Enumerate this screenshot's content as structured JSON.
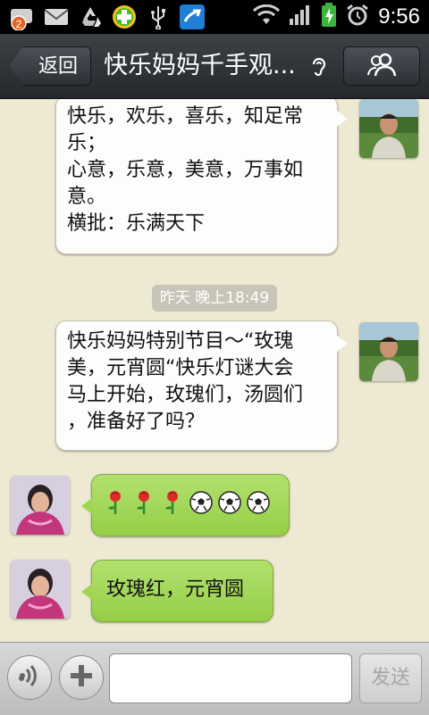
{
  "status_bar": {
    "notification_count": "2",
    "time": "9:56"
  },
  "header": {
    "back_label": "返回",
    "title": "快乐妈妈千手观..."
  },
  "messages": [
    {
      "side": "right",
      "lines": [
        "快乐，欢乐，喜乐，知足常",
        "乐；",
        "心意，乐意，美意，万事如",
        "意。",
        "横批：乐满天下"
      ]
    },
    {
      "timestamp": "昨天 晚上18:49"
    },
    {
      "side": "right",
      "lines": [
        "快乐妈妈特别节目～“玫瑰",
        "美，元宵圆“快乐灯谜大会",
        "马上开始，玫瑰们，汤圆们",
        "，准备好了吗？"
      ]
    },
    {
      "side": "left",
      "emoji": [
        "rose-icon",
        "rose-icon",
        "rose-icon",
        "soccer-ball-icon",
        "soccer-ball-icon",
        "soccer-ball-icon"
      ]
    },
    {
      "side": "left",
      "lines": [
        "玫瑰红，元宵圆"
      ]
    }
  ],
  "input_bar": {
    "send_label": "发送",
    "input_value": ""
  },
  "colors": {
    "chat_background": "#ede9d2",
    "incoming_bubble": "#9fd552",
    "outgoing_bubble": "#fdfdfb",
    "title_bar": "#2b2f33"
  }
}
